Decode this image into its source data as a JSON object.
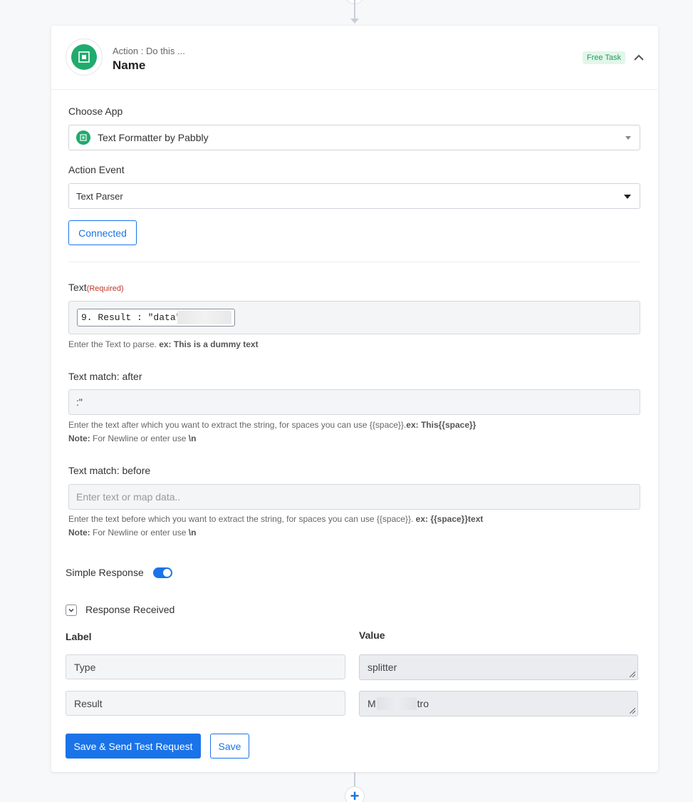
{
  "header": {
    "subtitle": "Action : Do this ...",
    "title": "Name",
    "badge": "Free Task"
  },
  "choose_app": {
    "label": "Choose App",
    "value": "Text Formatter by Pabbly"
  },
  "action_event": {
    "label": "Action Event",
    "value": "Text Parser"
  },
  "connected_label": "Connected",
  "text_field": {
    "label": "Text",
    "required": "(Required)",
    "pill_value": "9. Result : \"data\":\"M",
    "help": "Enter the Text to parse.",
    "help_example": "ex: This is a dummy text"
  },
  "match_after": {
    "label": "Text match: after",
    "value": ":\"",
    "help": "Enter the text after which you want to extract the string, for spaces you can use {{space}}.",
    "help_example": "ex: This{{space}}",
    "note_label": "Note:",
    "note_text": "For Newline or enter use",
    "note_code": "\\n"
  },
  "match_before": {
    "label": "Text match: before",
    "placeholder": "Enter text or map data..",
    "help": "Enter the text before which you want to extract the string, for spaces you can use {{space}}.",
    "help_example": "ex: {{space}}text",
    "note_label": "Note:",
    "note_text": "For Newline or enter use",
    "note_code": "\\n"
  },
  "simple_response": {
    "label": "Simple Response",
    "enabled": true
  },
  "response_received": {
    "label": "Response Received",
    "label_header": "Label",
    "value_header": "Value",
    "rows": [
      {
        "label": "Type",
        "value": "splitter"
      },
      {
        "label": "Result",
        "value_start": "M",
        "value_end": "tro"
      }
    ]
  },
  "buttons": {
    "primary": "Save & Send Test Request",
    "secondary": "Save"
  },
  "add_step_symbol": "+",
  "colors": {
    "primary": "#1a73e8",
    "app_green": "#1fab6e",
    "badge_bg": "#e2f6ea",
    "required_red": "#c0392b"
  }
}
